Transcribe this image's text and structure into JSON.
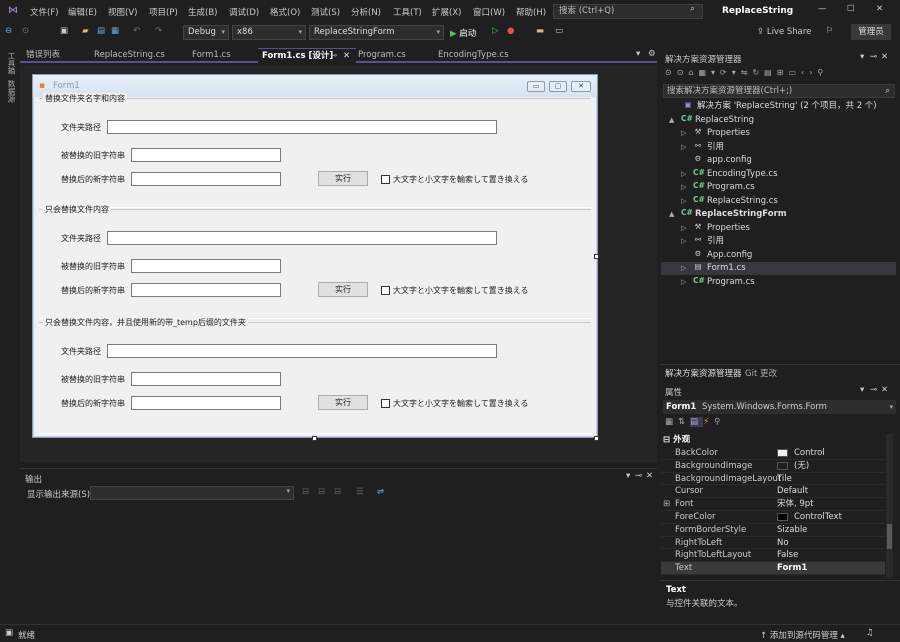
{
  "menu": {
    "items": [
      "文件(F)",
      "编辑(E)",
      "视图(V)",
      "项目(P)",
      "生成(B)",
      "调试(D)",
      "格式(O)",
      "测试(S)",
      "分析(N)",
      "工具(T)",
      "扩展(X)",
      "窗口(W)",
      "帮助(H)"
    ],
    "search_placeholder": "搜索 (Ctrl+Q)",
    "app_title": "ReplaceString",
    "minimize": "—",
    "restore": "☐",
    "close": "✕"
  },
  "toolbar": {
    "config": "Debug",
    "platform": "x86",
    "startup_project": "ReplaceStringForm",
    "start_label": "启动",
    "live_share": "Live Share",
    "admin_badge": "管理员"
  },
  "left_strip": {
    "toolbox": "工具箱",
    "datasource": "数据源"
  },
  "tabs": [
    {
      "label": "错误列表"
    },
    {
      "label": "ReplaceString.cs"
    },
    {
      "label": "Form1.cs"
    },
    {
      "label": "Form1.cs [设计]"
    },
    {
      "label": "Program.cs"
    },
    {
      "label": "EncodingType.cs"
    }
  ],
  "form": {
    "title": "Form1",
    "groups": [
      {
        "title": "替换文件夹名字和内容",
        "folder_label": "文件夹路径",
        "old_label": "被替换的旧字符串",
        "new_label": "替换后的新字符串",
        "button": "实行",
        "checkbox": "大文字と小文字を輸索して置き換える"
      },
      {
        "title": "只会替换文件内容",
        "folder_label": "文件夹路径",
        "old_label": "被替换的旧字符串",
        "new_label": "替换后的新字符串",
        "button": "实行",
        "checkbox": "大文字と小文字を輸索して置き換える"
      },
      {
        "title": "只会替换文件内容，并且使用新的带_temp后缀的文件夹",
        "folder_label": "文件夹路径",
        "old_label": "被替换的旧字符串",
        "new_label": "替换后的新字符串",
        "button": "实行",
        "checkbox": "大文字と小文字を輸索して置き換える"
      }
    ]
  },
  "output": {
    "title": "输出",
    "source_label": "显示输出来源(S):"
  },
  "solution_explorer": {
    "title": "解决方案资源管理器",
    "search_placeholder": "搜索解决方案资源管理器(Ctrl+;)",
    "tree": [
      {
        "label": "解决方案 'ReplaceString' (2 个项目，共 2 个)",
        "level": 0,
        "icon": "solution-icon",
        "arrow": "",
        "bold": false
      },
      {
        "label": "ReplaceString",
        "level": 1,
        "icon": "project-icon",
        "arrow": "▲",
        "bold": false
      },
      {
        "label": "Properties",
        "level": 2,
        "icon": "wrench-icon",
        "arrow": "▷",
        "bold": false
      },
      {
        "label": "引用",
        "level": 2,
        "icon": "reference-icon",
        "arrow": "▷",
        "bold": false
      },
      {
        "label": "app.config",
        "level": 2,
        "icon": "config-icon",
        "arrow": "",
        "bold": false
      },
      {
        "label": "EncodingType.cs",
        "level": 2,
        "icon": "csharp-icon",
        "arrow": "▷",
        "bold": false
      },
      {
        "label": "Program.cs",
        "level": 2,
        "icon": "csharp-icon",
        "arrow": "▷",
        "bold": false
      },
      {
        "label": "ReplaceString.cs",
        "level": 2,
        "icon": "csharp-icon",
        "arrow": "▷",
        "bold": false
      },
      {
        "label": "ReplaceStringForm",
        "level": 1,
        "icon": "project-icon",
        "arrow": "▲",
        "bold": true
      },
      {
        "label": "Properties",
        "level": 2,
        "icon": "wrench-icon",
        "arrow": "▷",
        "bold": false
      },
      {
        "label": "引用",
        "level": 2,
        "icon": "reference-icon",
        "arrow": "▷",
        "bold": false
      },
      {
        "label": "App.config",
        "level": 2,
        "icon": "config-icon",
        "arrow": "",
        "bold": false
      },
      {
        "label": "Form1.cs",
        "level": 2,
        "icon": "form-icon",
        "arrow": "▷",
        "bold": false,
        "selected": true
      },
      {
        "label": "Program.cs",
        "level": 2,
        "icon": "csharp-icon",
        "arrow": "▷",
        "bold": false
      }
    ],
    "bottom_tabs": [
      "解决方案资源管理器",
      "Git 更改"
    ]
  },
  "properties": {
    "title": "属性",
    "object_name": "Form1",
    "object_type": "System.Windows.Forms.Form",
    "category": "外观",
    "rows": [
      {
        "name": "BackColor",
        "value": "Control",
        "swatch": "#f0f0f0"
      },
      {
        "name": "BackgroundImage",
        "value": "(无)",
        "swatch": "#1f1f1f"
      },
      {
        "name": "BackgroundImageLayout",
        "value": "Tile"
      },
      {
        "name": "Cursor",
        "value": "Default"
      },
      {
        "name": "Font",
        "value": "宋体, 9pt",
        "expand": "⊞"
      },
      {
        "name": "ForeColor",
        "value": "ControlText",
        "swatch": "#000000"
      },
      {
        "name": "FormBorderStyle",
        "value": "Sizable"
      },
      {
        "name": "RightToLeft",
        "value": "No"
      },
      {
        "name": "RightToLeftLayout",
        "value": "False"
      },
      {
        "name": "Text",
        "value": "Form1",
        "selected": true
      }
    ],
    "desc_title": "Text",
    "desc_text": "与控件关联的文本。"
  },
  "status": {
    "ready": "就绪",
    "source_control": "添加到源代码管理"
  },
  "colors": {
    "accent": "#5b4c9c",
    "selection": "#37373d"
  }
}
